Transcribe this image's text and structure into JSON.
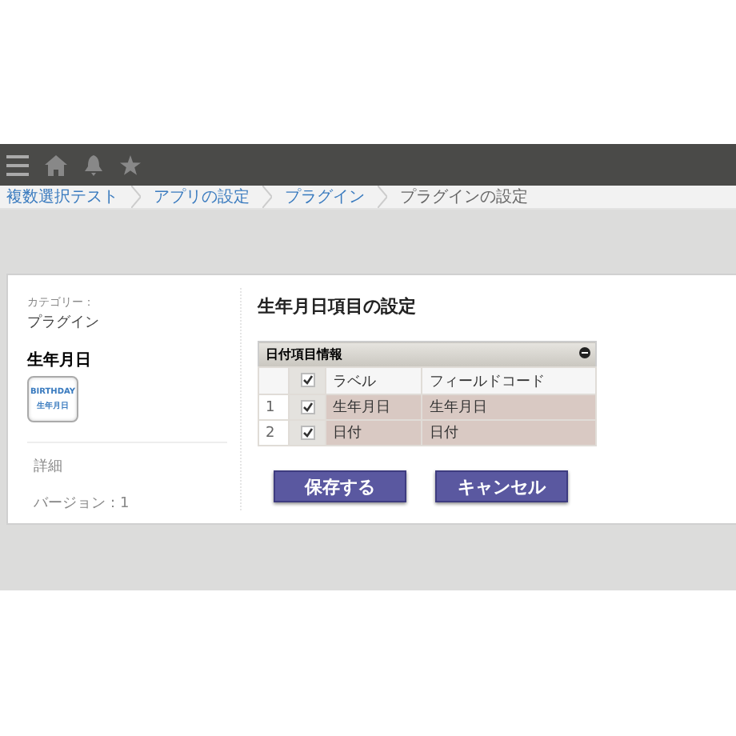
{
  "breadcrumb": [
    {
      "label": "複数選択テスト",
      "current": false
    },
    {
      "label": "アプリの設定",
      "current": false
    },
    {
      "label": "プラグイン",
      "current": false
    },
    {
      "label": "プラグインの設定",
      "current": true
    }
  ],
  "sidebar": {
    "category_label": "カテゴリー：",
    "category": "プラグイン",
    "plugin_name": "生年月日",
    "icon_lines": [
      "BIRTHDAY",
      "生年月日"
    ],
    "details_label": "詳細",
    "version": "バージョン：1"
  },
  "settings": {
    "title": "生年月日項目の設定",
    "table": {
      "title": "日付項目情報",
      "header_checked": true,
      "columns": [
        "ラベル",
        "フィールドコード"
      ],
      "rows": [
        {
          "index": "1",
          "checked": true,
          "label": "生年月日",
          "field_code": "生年月日"
        },
        {
          "index": "2",
          "checked": true,
          "label": "日付",
          "field_code": "日付"
        }
      ]
    },
    "buttons": [
      {
        "label": "保存する"
      },
      {
        "label": "キャンセル"
      }
    ]
  }
}
